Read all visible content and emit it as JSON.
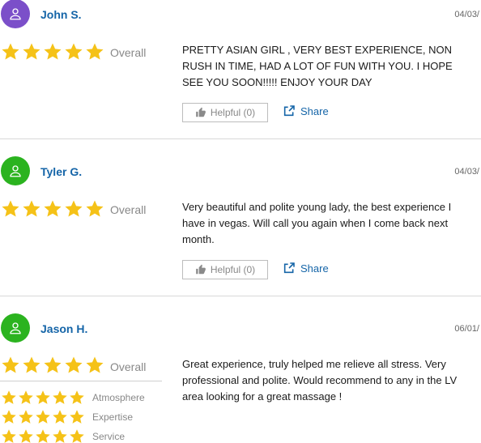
{
  "reviews": [
    {
      "name": "John S.",
      "date": "04/03/",
      "avatar_color": "#7b4fc9",
      "rating": 5,
      "overall_label": "Overall",
      "text_lines": [
        "PRETTY ASIAN GIRL , VERY BEST EXPERIENCE, NON",
        "RUSH IN TIME, HAD A LOT OF FUN WITH YOU. I HOPE",
        "SEE YOU SOON!!!!! ENJOY YOUR DAY"
      ],
      "helpful_label": "Helpful (0)",
      "share_label": "Share"
    },
    {
      "name": "Tyler G.",
      "date": "04/03/",
      "avatar_color": "#2bb31f",
      "rating": 5,
      "overall_label": "Overall",
      "text_lines": [
        "Very beautiful and polite young lady, the best experience I",
        "have in vegas. Will call you again when I come back next",
        "month."
      ],
      "helpful_label": "Helpful (0)",
      "share_label": "Share"
    },
    {
      "name": "Jason H.",
      "date": "06/01/",
      "avatar_color": "#2bb31f",
      "rating": 5,
      "overall_label": "Overall",
      "text_lines": [
        "Great experience, truly helped me relieve all stress. Very",
        "professional and polite. Would recommend to any in the LV",
        "area looking for a great massage !"
      ],
      "sub_ratings": [
        {
          "label": "Atmosphere",
          "rating": 5
        },
        {
          "label": "Expertise",
          "rating": 5
        },
        {
          "label": "Service",
          "rating": 5
        }
      ]
    }
  ],
  "colors": {
    "star": "#f5c218",
    "link": "#1565a8",
    "muted": "#888888"
  },
  "icons": {
    "avatar": "user-outline-icon",
    "star": "star-icon",
    "helpful": "thumbs-up-icon",
    "share": "share-external-icon"
  }
}
